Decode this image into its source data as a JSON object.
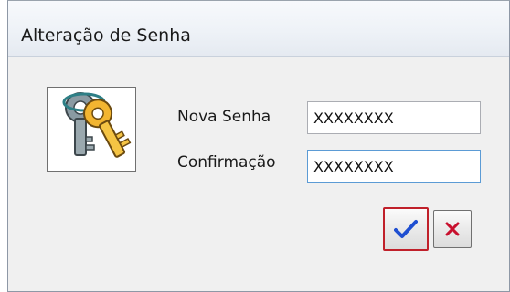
{
  "window": {
    "title": "Alteração de Senha"
  },
  "form": {
    "new_password_label": "Nova Senha",
    "new_password_value": "XXXXXXXX",
    "confirm_label": "Confirmação",
    "confirm_value": "XXXXXXXX"
  },
  "buttons": {
    "ok_icon": "checkmark-icon",
    "cancel_icon": "close-icon"
  },
  "icons": {
    "dialog_icon": "keys-icon"
  },
  "colors": {
    "ok_border": "#c0202a",
    "check": "#1f4fd1",
    "cross": "#c8102e"
  }
}
